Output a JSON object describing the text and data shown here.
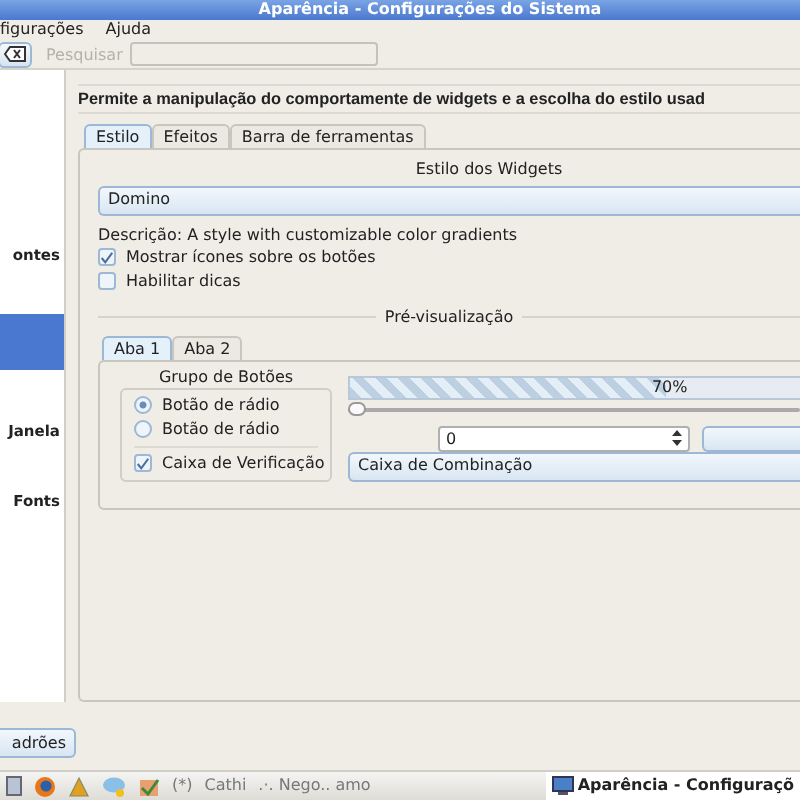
{
  "window": {
    "title": "Aparência - Configurações do Sistema"
  },
  "menu": [
    "figurações",
    "Ajuda"
  ],
  "toolbar": {
    "search_label": "Pesquisar",
    "search_disabled": true
  },
  "sidebar": {
    "items": [
      {
        "label": "ontes",
        "selected": false
      },
      {
        "selected": true
      },
      {
        "label": "Janela",
        "selected": false
      },
      {
        "label": "Fonts",
        "selected": false
      }
    ]
  },
  "header": "Permite a manipulação do comportamente de widgets e a escolha do estilo usad",
  "tabs": [
    {
      "label": "Estilo",
      "selected": true
    },
    {
      "label": "Efeitos",
      "selected": false
    },
    {
      "label": "Barra de ferramentas",
      "selected": false
    }
  ],
  "style_group": {
    "title": "Estilo dos Widgets",
    "combo": "Domino",
    "description": "Descrição: A style with customizable color gradients",
    "options": [
      {
        "label": "Mostrar ícones sobre os botões",
        "checked": true
      },
      {
        "label": "Habilitar dicas",
        "checked": false
      }
    ]
  },
  "preview": {
    "title": "Pré-visualização",
    "tabs": [
      {
        "label": "Aba 1",
        "selected": true
      },
      {
        "label": "Aba 2",
        "selected": false
      }
    ],
    "button_group": {
      "title": "Grupo de Botões",
      "radios": [
        {
          "label": "Botão de rádio",
          "selected": true
        },
        {
          "label": "Botão de rádio",
          "selected": false
        }
      ],
      "checkbox": {
        "label": "Caixa de Verificação",
        "checked": true
      }
    },
    "progress": {
      "level": 0.7,
      "reading": "70%"
    },
    "slider": {
      "level": 0
    },
    "spinbox": "0",
    "combo": "Caixa de Combinação"
  },
  "defaults_button": "adrões",
  "taskbar": {
    "tasks": [
      {
        "label": "(*)",
        "active": false
      },
      {
        "label": "Cathi",
        "active": false
      },
      {
        "label": ".·. Nego.. amo",
        "active": false
      },
      {
        "label": "Aparência - Configuraçõ",
        "active": true
      }
    ]
  }
}
